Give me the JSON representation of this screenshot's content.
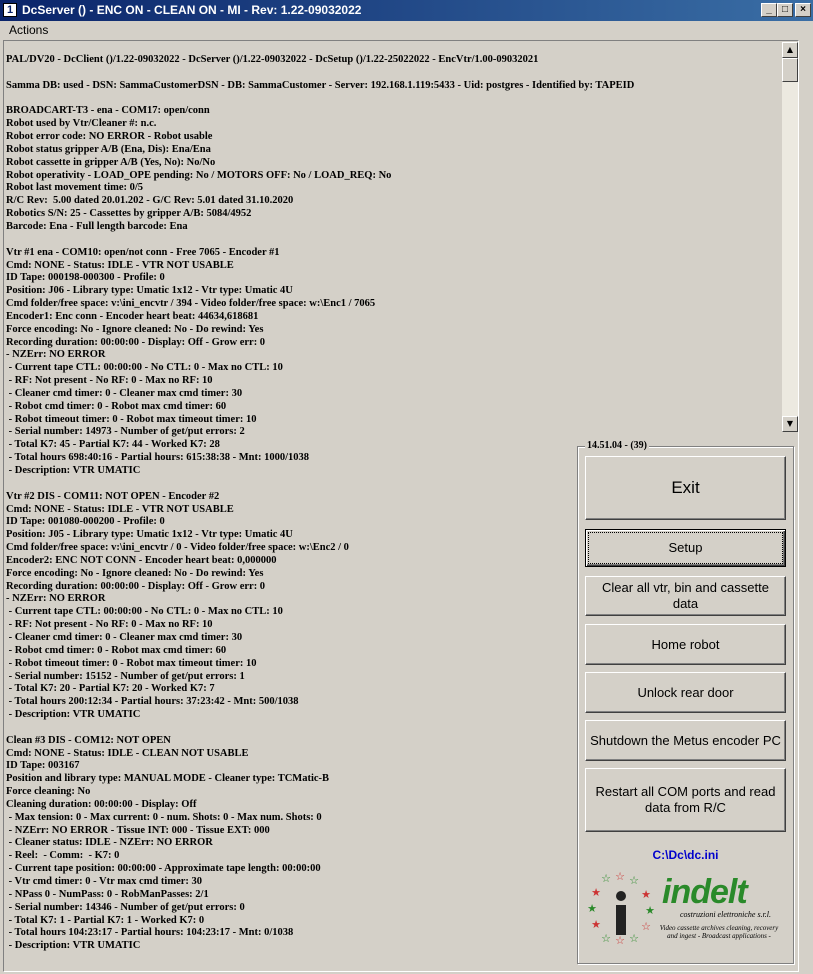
{
  "window": {
    "title": "DcServer () - ENC ON - CLEAN ON - MI - Rev: 1.22-09032022",
    "controls": {
      "minimize": "_",
      "maximize": "□",
      "close": "×"
    }
  },
  "menu": {
    "actions": "Actions"
  },
  "log": {
    "lines": [
      "PAL/DV20 - DcClient ()/1.22-09032022 - DcServer ()/1.22-09032022 - DcSetup ()/1.22-25022022 - EncVtr/1.00-09032021",
      "",
      "Samma DB: used - DSN: SammaCustomerDSN - DB: SammaCustomer - Server: 192.168.1.119:5433 - Uid: postgres - Identified by: TAPEID",
      "",
      "BROADCART-T3 - ena - COM17: open/conn",
      "Robot used by Vtr/Cleaner #: n.c.",
      "Robot error code: NO ERROR - Robot usable",
      "Robot status gripper A/B (Ena, Dis): Ena/Ena",
      "Robot cassette in gripper A/B (Yes, No): No/No",
      "Robot operativity - LOAD_OPE pending: No / MOTORS OFF: No / LOAD_REQ: No",
      "Robot last movement time: 0/5",
      "R/C Rev:  5.00 dated 20.01.202 - G/C Rev: 5.01 dated 31.10.2020",
      "Robotics S/N: 25 - Cassettes by gripper A/B: 5084/4952",
      "Barcode: Ena - Full length barcode: Ena",
      "",
      "Vtr #1 ena - COM10: open/not conn - Free 7065 - Encoder #1",
      "Cmd: NONE - Status: IDLE - VTR NOT USABLE",
      "ID Tape: 000198-000300 - Profile: 0",
      "Position: J06 - Library type: Umatic 1x12 - Vtr type: Umatic 4U",
      "Cmd folder/free space: v:\\ini_encvtr / 394 - Video folder/free space: w:\\Enc1 / 7065",
      "Encoder1: Enc conn - Encoder heart beat: 44634,618681",
      "Force encoding: No - Ignore cleaned: No - Do rewind: Yes",
      "Recording duration: 00:00:00 - Display: Off - Grow err: 0",
      "- NZErr: NO ERROR",
      " - Current tape CTL: 00:00:00 - No CTL: 0 - Max no CTL: 10",
      " - RF: Not present - No RF: 0 - Max no RF: 10",
      " - Cleaner cmd timer: 0 - Cleaner max cmd timer: 30",
      " - Robot cmd timer: 0 - Robot max cmd timer: 60",
      " - Robot timeout timer: 0 - Robot max timeout timer: 10",
      " - Serial number: 14973 - Number of get/put errors: 2",
      " - Total K7: 45 - Partial K7: 44 - Worked K7: 28",
      " - Total hours 698:40:16 - Partial hours: 615:38:38 - Mnt: 1000/1038",
      " - Description: VTR UMATIC",
      "",
      "Vtr #2 DIS - COM11: NOT OPEN - Encoder #2",
      "Cmd: NONE - Status: IDLE - VTR NOT USABLE",
      "ID Tape: 001080-000200 - Profile: 0",
      "Position: J05 - Library type: Umatic 1x12 - Vtr type: Umatic 4U",
      "Cmd folder/free space: v:\\ini_encvtr / 0 - Video folder/free space: w:\\Enc2 / 0",
      "Encoder2: ENC NOT CONN - Encoder heart beat: 0,000000",
      "Force encoding: No - Ignore cleaned: No - Do rewind: Yes",
      "Recording duration: 00:00:00 - Display: Off - Grow err: 0",
      "- NZErr: NO ERROR",
      " - Current tape CTL: 00:00:00 - No CTL: 0 - Max no CTL: 10",
      " - RF: Not present - No RF: 0 - Max no RF: 10",
      " - Cleaner cmd timer: 0 - Cleaner max cmd timer: 30",
      " - Robot cmd timer: 0 - Robot max cmd timer: 60",
      " - Robot timeout timer: 0 - Robot max timeout timer: 10",
      " - Serial number: 15152 - Number of get/put errors: 1",
      " - Total K7: 20 - Partial K7: 20 - Worked K7: 7",
      " - Total hours 200:12:34 - Partial hours: 37:23:42 - Mnt: 500/1038",
      " - Description: VTR UMATIC",
      "",
      "Clean #3 DIS - COM12: NOT OPEN",
      "Cmd: NONE - Status: IDLE - CLEAN NOT USABLE",
      "ID Tape: 003167",
      "Position and library type: MANUAL MODE - Cleaner type: TCMatic-B",
      "Force cleaning: No",
      "Cleaning duration: 00:00:00 - Display: Off",
      " - Max tension: 0 - Max current: 0 - num. Shots: 0 - Max num. Shots: 0",
      " - NZErr: NO ERROR - Tissue INT: 000 - Tissue EXT: 000",
      " - Cleaner status: IDLE - NZErr: NO ERROR",
      " - Reel:  - Comm:  - K7: 0",
      " - Current tape position: 00:00:00 - Approximate tape length: 00:00:00",
      " - Vtr cmd timer: 0 - Vtr max cmd timer: 30",
      " - NPass 0 - NumPass: 0 - RobManPasses: 2/1",
      " - Serial number: 14346 - Number of get/put errors: 0",
      " - Total K7: 1 - Partial K7: 1 - Worked K7: 0",
      " - Total hours 104:23:17 - Partial hours: 104:23:17 - Mnt: 0/1038",
      " - Description: VTR UMATIC"
    ]
  },
  "scrollbar": {
    "up_arrow": "▲",
    "down_arrow": "▼"
  },
  "panel": {
    "time_label": "14.51.04 - (39)",
    "buttons": {
      "exit": "Exit",
      "setup": "Setup",
      "clear_all": "Clear all vtr, bin and cassette data",
      "home_robot": "Home robot",
      "unlock_rear_door": "Unlock rear door",
      "shutdown_encoder": "Shutdown the Metus encoder PC",
      "restart_com": "Restart all COM ports and read data from R/C"
    },
    "config_path": "C:\\Dc\\dc.ini"
  },
  "logo": {
    "brand": "indelt",
    "subtitle": "costruzioni elettroniche s.r.l.",
    "tagline": "Video cassette archives cleaning, recovery and ingest - Broadcast applications -"
  }
}
